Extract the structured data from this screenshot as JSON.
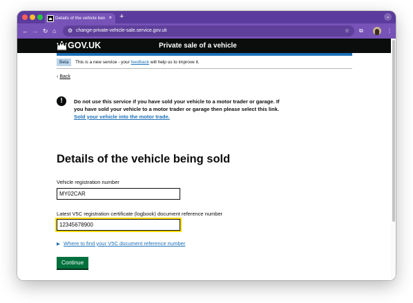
{
  "browser": {
    "tab_title": "Details of the vehicle being s",
    "tab_close": "×",
    "new_tab": "+",
    "url": "change-private-vehicle-sale.service.gov.uk"
  },
  "header": {
    "logo_text": "GOV.UK",
    "service_name": "Private sale of a vehicle"
  },
  "phase_banner": {
    "tag": "Beta",
    "text_before": "This is a new service - your ",
    "link": "feedback",
    "text_after": " will help us to improve it."
  },
  "back_link": "Back",
  "warning": {
    "icon": "!",
    "text": "Do not use this service if you have sold your vehicle to a motor trader or garage. If you have sold your vehicle to a motor trader or garage then please select this link. ",
    "link": "Sold your vehicle into the motor trade."
  },
  "page_title": "Details of the vehicle being sold",
  "form": {
    "registration_label": "Vehicle registration number",
    "registration_value": "MY02CAR",
    "v5c_label": "Latest V5C registration certificate (logbook) document reference number",
    "v5c_value": "12345678900",
    "details_summary": "Where to find your V5C document reference number",
    "continue_label": "Continue"
  },
  "colors": {
    "browser_chrome": "#7753b8",
    "govuk_black": "#0b0c0c",
    "govuk_blue": "#1d70b8",
    "govuk_green": "#00703c",
    "focus_yellow": "#ffdd00"
  }
}
